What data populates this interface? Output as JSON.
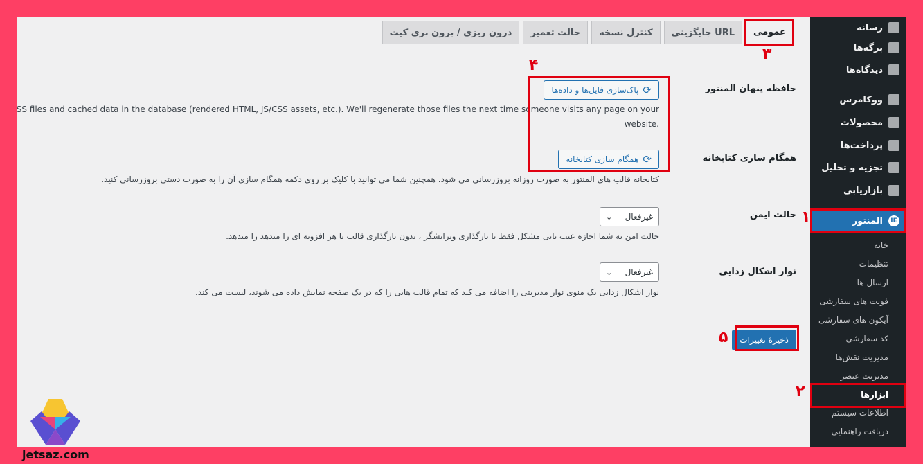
{
  "sidebar": {
    "items": [
      {
        "label": "رسانه",
        "icon": "media-icon"
      },
      {
        "label": "برگه‌ها",
        "icon": "pages-icon"
      },
      {
        "label": "دیدگاه‌ها",
        "icon": "comments-icon"
      },
      {
        "label": "ووکامرس",
        "icon": "woocommerce-icon"
      },
      {
        "label": "محصولات",
        "icon": "products-icon"
      },
      {
        "label": "پرداخت‌ها",
        "icon": "payments-icon"
      },
      {
        "label": "تجزیه و تحلیل",
        "icon": "analytics-icon"
      },
      {
        "label": "بازاریابی",
        "icon": "marketing-icon"
      },
      {
        "label": "المنتور",
        "icon": "elementor-icon"
      }
    ],
    "elementor_badge": "IE",
    "submenu": [
      {
        "label": "خانه"
      },
      {
        "label": "تنظیمات"
      },
      {
        "label": "ارسال ها"
      },
      {
        "label": "فونت های سفارشی"
      },
      {
        "label": "آیکون های سفارشی"
      },
      {
        "label": "کد سفارشی"
      },
      {
        "label": "مدیریت نقش‌ها"
      },
      {
        "label": "مدیریت عنصر"
      },
      {
        "label": "ابزارها"
      },
      {
        "label": "اطلاعات سیستم"
      },
      {
        "label": "دریافت راهنمایی"
      }
    ]
  },
  "tabs": [
    {
      "label": "عمومی",
      "active": true
    },
    {
      "label": "جایگزینی URL"
    },
    {
      "label": "کنترل نسخه"
    },
    {
      "label": "حالت تعمیر"
    },
    {
      "label": "درون ریزی / برون بری کیت"
    }
  ],
  "cache": {
    "label": "حافظه پنهان المنتور",
    "button": "پاک‌سازی فایل‌ها و داده‌ها",
    "desc_line1": "r outdated CSS files and cached data in the database (rendered HTML, JS/CSS assets, etc.). We'll regenerate those files the next time someone visits any page on your",
    "desc_line2": "website."
  },
  "library": {
    "label": "همگام سازی کتابخانه",
    "button": "همگام سازی کتابخانه",
    "desc": "کتابخانه قالب های المنتور به صورت روزانه بروزرسانی می شود. همچنین شما می توانید با کلیک بر روی دکمه همگام سازی آن را به صورت دستی بروزرسانی کنید."
  },
  "safe_mode": {
    "label": "حالت ایمن",
    "value": "غیرفعال",
    "desc": "حالت امن به شما اجازه عیب یابی مشکل فقط با بارگذاری ویرایشگر ، بدون بارگذاری قالب یا هر افزونه ای را میدهد را میدهد."
  },
  "debug_bar": {
    "label": "نوار اشکال زدایی",
    "value": "غیرفعال",
    "desc": "نوار اشکال زدایی یک منوی نوار مدیریتی را اضافه می کند که تمام قالب هایی را که در یک صفحه نمایش داده می شوند، لیست می کند."
  },
  "save_button": "ذخیرهٔ تغییرات",
  "annotations": [
    "۱",
    "۲",
    "۳",
    "۴",
    "۵"
  ],
  "watermark": "jetsaz.com",
  "colors": {
    "accent": "#2271b1",
    "annotation": "#e00010",
    "frame": "#fe3f64",
    "sidebar": "#1d2327"
  }
}
